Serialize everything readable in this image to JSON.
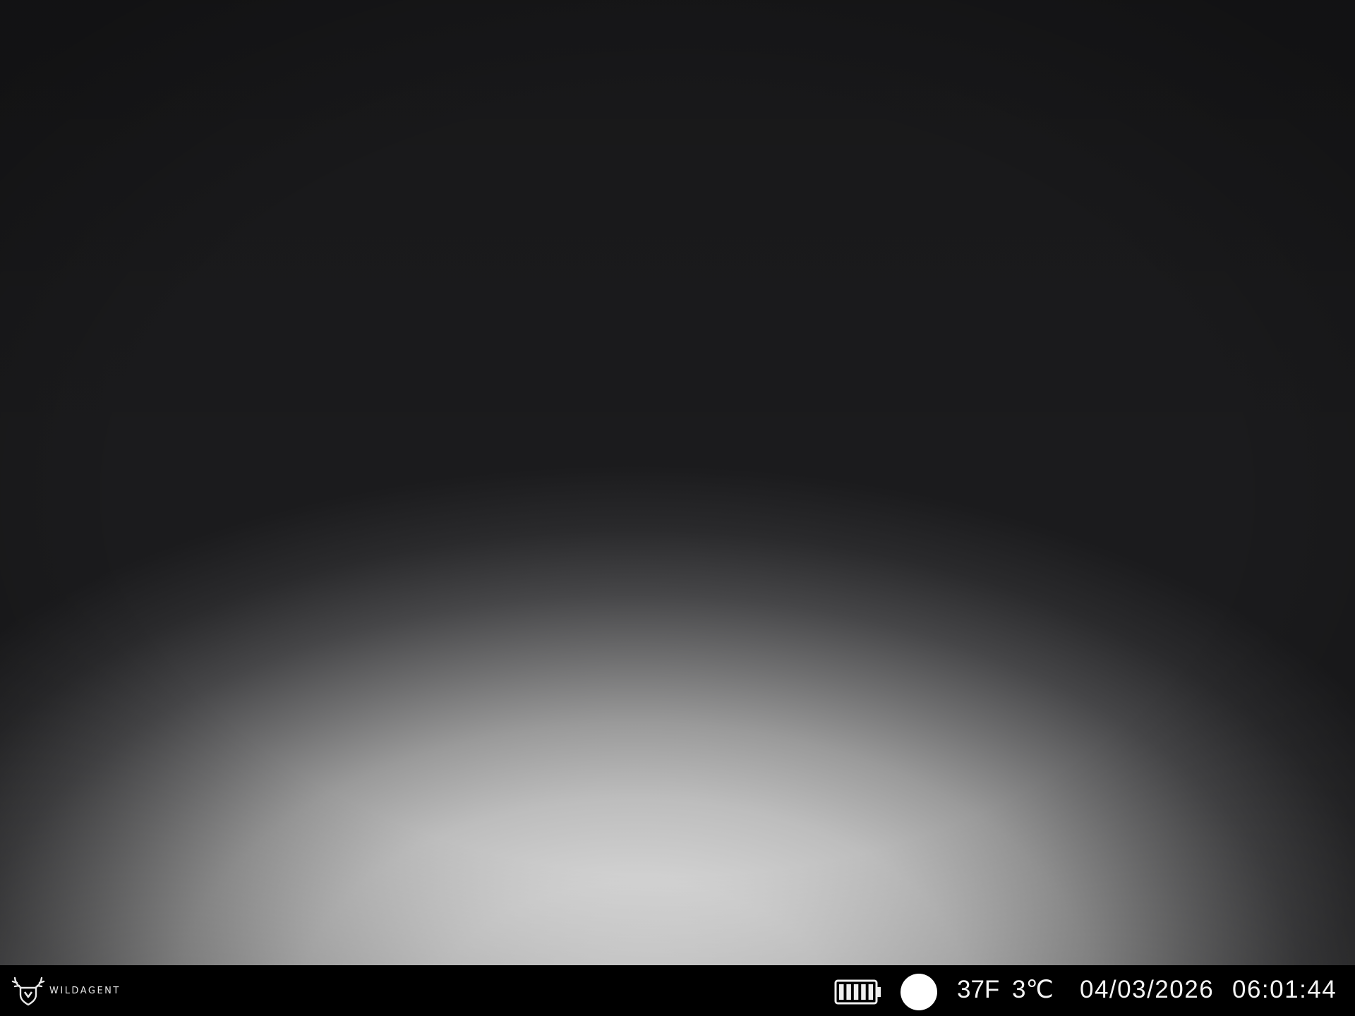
{
  "brand": {
    "name": "WILDAGENT",
    "logo_icon": "deer-head-shield-icon"
  },
  "status": {
    "battery_icon": "battery-full-icon",
    "battery_level": 1.0,
    "moon_icon": "full-moon-icon",
    "temperature_f": "37F",
    "temperature_c": "3℃",
    "date": "04/03/2026",
    "time": "06:01:44"
  },
  "colors": {
    "info_bar_background": "#000000",
    "info_text": "#f4f4f4"
  }
}
